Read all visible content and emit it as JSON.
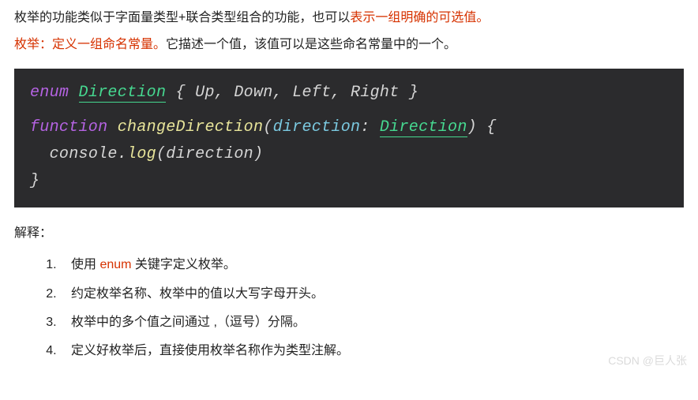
{
  "intro": {
    "line1_a": "枚举的功能类似于字面量类型+联合类型组合的功能，也可以",
    "line1_b": "表示一组明确的可选值。",
    "line2_a": "枚举：定义一组命名常量。",
    "line2_b": "它描述一个值，该值可以是这些命名常量中的一个。"
  },
  "code": {
    "kw_enum": "enum",
    "type_direction": "Direction",
    "brace_open": " { ",
    "val_up": "Up",
    "comma1": ", ",
    "val_down": "Down",
    "comma2": ", ",
    "val_left": "Left",
    "comma3": ", ",
    "val_right": "Right",
    "brace_close": " }",
    "kw_function": "function",
    "fn_name": "changeDirection",
    "paren_open": "(",
    "param_name": "direction",
    "colon": ": ",
    "param_type": "Direction",
    "paren_close": ")",
    "body_open": " {",
    "console": "console",
    "dot": ".",
    "log": "log",
    "arg_open": "(",
    "arg": "direction",
    "arg_close": ")",
    "body_close": "}"
  },
  "explain": {
    "title": "解释：",
    "items": {
      "1a": "使用 ",
      "1kw": "enum",
      "1b": " 关键字定义枚举。",
      "2": "约定枚举名称、枚举中的值以大写字母开头。",
      "3": "枚举中的多个值之间通过 ,（逗号）分隔。",
      "4": "定义好枚举后，直接使用枚举名称作为类型注解。"
    }
  },
  "watermark": "CSDN @巨人张"
}
